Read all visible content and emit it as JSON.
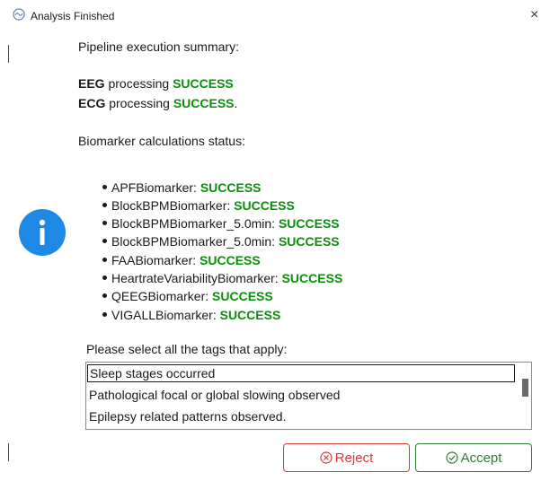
{
  "window": {
    "title": "Analysis Finished",
    "close_glyph": "×",
    "app_icon": "app-logo-icon",
    "info_icon": "info-icon",
    "info_color": "#1e88e5"
  },
  "summary": {
    "heading": "Pipeline execution summary:",
    "eeg": {
      "label": "EEG",
      "text": " processing ",
      "status": "SUCCESS",
      "suffix": ""
    },
    "ecg": {
      "label": "ECG",
      "text": " processing ",
      "status": "SUCCESS",
      "suffix": "."
    }
  },
  "biomarkers": {
    "heading": "Biomarker calculations status:",
    "items": [
      {
        "name": "APFBiomarker:",
        "status": "SUCCESS"
      },
      {
        "name": "BlockBPMBiomarker:",
        "status": "SUCCESS"
      },
      {
        "name": "BlockBPMBiomarker_5.0min:",
        "status": "SUCCESS"
      },
      {
        "name": "BlockBPMBiomarker_5.0min:",
        "status": "SUCCESS"
      },
      {
        "name": "FAABiomarker:",
        "status": "SUCCESS"
      },
      {
        "name": "HeartrateVariabilityBiomarker:",
        "status": "SUCCESS"
      },
      {
        "name": "QEEGBiomarker:",
        "status": "SUCCESS"
      },
      {
        "name": "VIGALLBiomarker:",
        "status": "SUCCESS"
      }
    ]
  },
  "tags": {
    "prompt": "Please select all the tags that apply:",
    "options": [
      "Sleep stages occurred",
      "Pathological focal or global slowing observed",
      "Epilepsy related patterns observed."
    ],
    "selected_index": 0
  },
  "buttons": {
    "reject": "Reject",
    "accept": "Accept",
    "reject_icon": "x-circle-icon",
    "accept_icon": "check-circle-icon",
    "reject_color": "#d93a3a",
    "accept_color": "#2f7d32"
  },
  "colors": {
    "success": "#0a8f0a"
  }
}
